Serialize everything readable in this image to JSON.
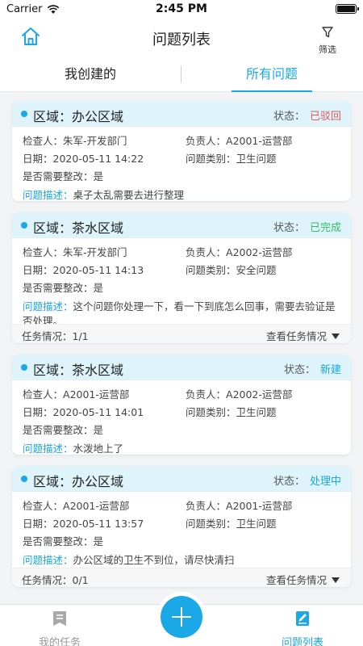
{
  "status_bar": {
    "carrier": "Carrier",
    "time": "2:45 PM"
  },
  "header": {
    "title": "问题列表",
    "filter_label": "筛选"
  },
  "tabs": [
    {
      "label": "我创建的"
    },
    {
      "label": "所有问题"
    }
  ],
  "labels": {
    "status": "状态：",
    "inspector": "检查人：",
    "owner": "负责人：",
    "date": "日期：",
    "category": "问题类别：",
    "rectify": "是否需要整改：",
    "desc": "问题描述：",
    "task_status": "任务情况：",
    "view_tasks": "查看任务情况"
  },
  "colors": {
    "accent": "#1aa8e6",
    "rejected": "#e05a5a",
    "done": "#2fbf6a",
    "new": "#1aa8e6",
    "processing": "#1aa8e6"
  },
  "cards": [
    {
      "area": "区域：办公区域",
      "status": "已驳回",
      "inspector": "朱军-开发部门",
      "owner": "A2001-运营部",
      "date": "2020-05-11 14:22",
      "category": "卫生问题",
      "rectify": "是",
      "desc": "桌子太乱需要去进行整理"
    },
    {
      "area": "区域：茶水区域",
      "status": "已完成",
      "inspector": "朱军-开发部门",
      "owner": "A2002-运营部",
      "date": "2020-05-11 14:13",
      "category": "安全问题",
      "rectify": "是",
      "desc": "这个问题你处理一下，看一下到底怎么回事，需要去验证是否处理。",
      "tasks": "1/1"
    },
    {
      "area": "区域：茶水区域",
      "status": "新建",
      "inspector": "A2001-运营部",
      "owner": "A2002-运营部",
      "date": "2020-05-11 14:01",
      "category": "卫生问题",
      "rectify": "是",
      "desc": "水泼地上了"
    },
    {
      "area": "区域：办公区域",
      "status": "处理中",
      "inspector": "A2001-运营部",
      "owner": "A2001-运营部",
      "date": "2020-05-11 13:57",
      "category": "卫生问题",
      "rectify": "是",
      "desc": "办公区域的卫生不到位，请尽快清扫",
      "tasks": "0/1"
    }
  ],
  "bottom_nav": {
    "my_tasks": "我的任务",
    "issue_list": "问题列表"
  }
}
